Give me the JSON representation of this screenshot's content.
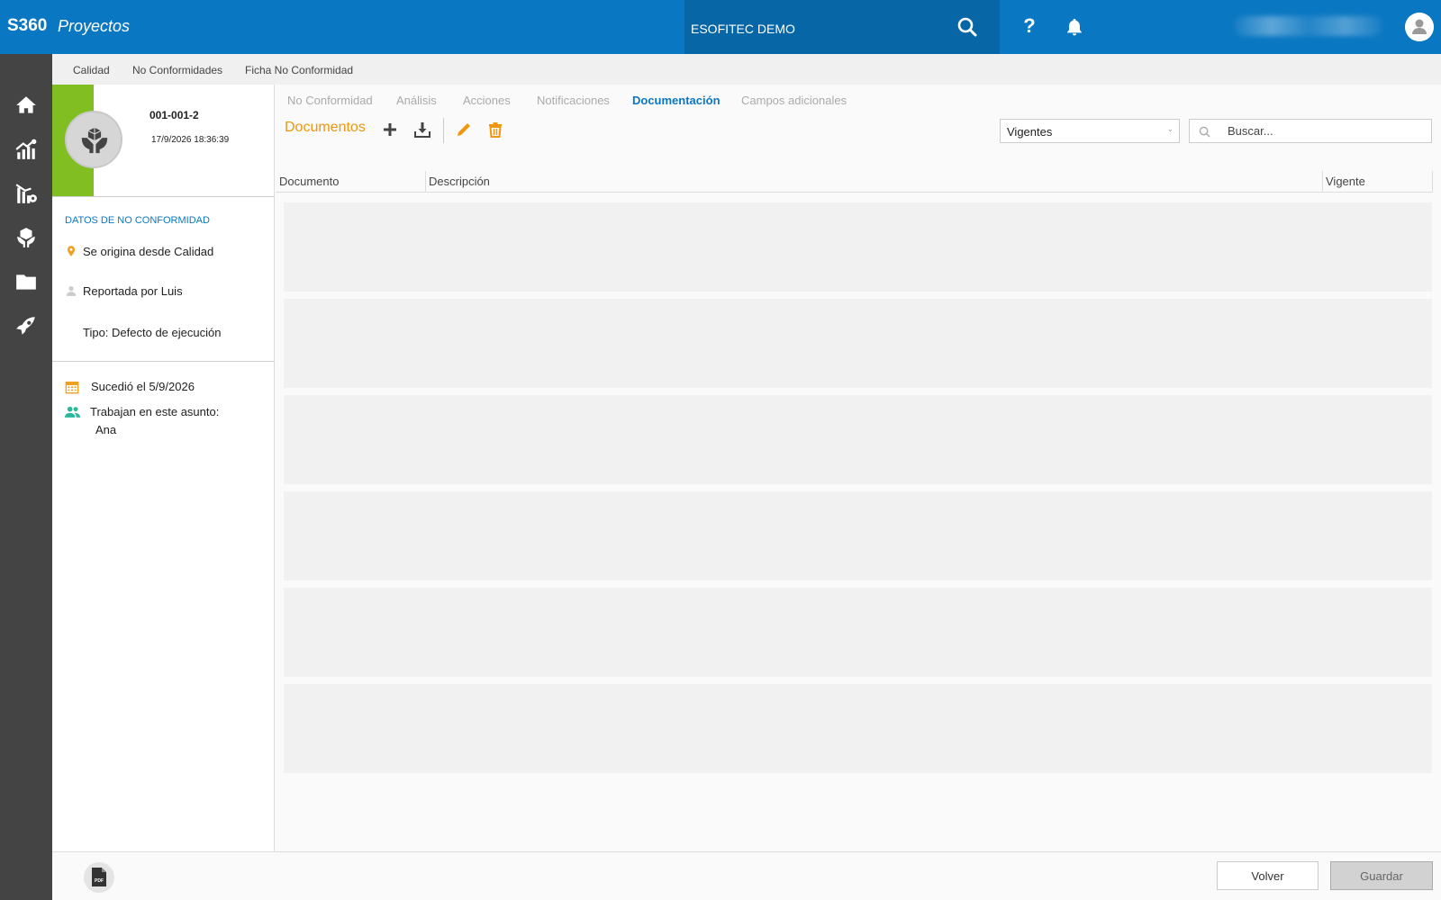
{
  "app": {
    "brand": "S360",
    "module": "Proyectos"
  },
  "header": {
    "company": "ESOFITEC DEMO",
    "help_label": "?"
  },
  "breadcrumb": [
    "Calidad",
    "No Conformidades",
    "Ficha No Conformidad"
  ],
  "record": {
    "code": "001-001-2",
    "datetime": "17/9/2026 18:36:39"
  },
  "left_panel": {
    "section_title": "DATOS DE NO CONFORMIDAD",
    "origin": "Se origina desde Calidad",
    "reported_by": "Reportada por Luis",
    "type": "Tipo: Defecto de ejecución",
    "occurred": "Sucedió el 5/9/2026",
    "working_label": "Trabajan en este asunto:",
    "working_people": "Ana"
  },
  "tabs": [
    {
      "label": "No Conformidad",
      "active": false
    },
    {
      "label": "Análisis",
      "active": false
    },
    {
      "label": "Acciones",
      "active": false
    },
    {
      "label": "Notificaciones",
      "active": false
    },
    {
      "label": "Documentación",
      "active": true
    },
    {
      "label": "Campos adicionales",
      "active": false
    }
  ],
  "documents": {
    "title": "Documentos",
    "filter_value": "Vigentes",
    "search_placeholder": "Buscar...",
    "columns": [
      "Documento",
      "Descripción",
      "Vigente"
    ],
    "rows": []
  },
  "footer": {
    "back_label": "Volver",
    "save_label": "Guardar",
    "pdf_label": "PDF"
  },
  "colors": {
    "topbar": "#0a77c2",
    "accent_orange": "#f0960f",
    "status_green": "#80be22",
    "rail": "#444444"
  }
}
